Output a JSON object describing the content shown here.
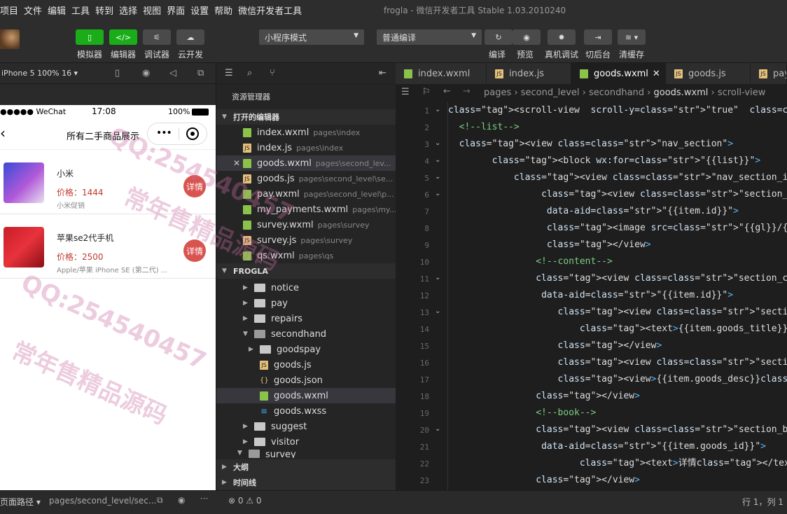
{
  "menu": [
    "项目",
    "文件",
    "编辑",
    "工具",
    "转到",
    "选择",
    "视图",
    "界面",
    "设置",
    "帮助",
    "微信开发者工具"
  ],
  "window_title": "frogla - 微信开发者工具 Stable 1.03.2010240",
  "toolbar": {
    "left_buttons": [
      "模拟器",
      "编辑器",
      "调试器",
      "云开发"
    ],
    "mode_select": "小程序模式",
    "compile_select": "普通编译",
    "right_buttons": [
      "编译",
      "预览",
      "真机调试",
      "切后台",
      "清缓存"
    ]
  },
  "simulator": {
    "device": "iPhone 5 100% 16 ▾",
    "status_left": "●●●●● WeChat",
    "status_time": "17:08",
    "status_battery": "100%",
    "nav_title": "所有二手商品展示",
    "items": [
      {
        "title": "小米",
        "price": "价格：1444",
        "desc": "小米促销",
        "button": "详情"
      },
      {
        "title": "苹果se2代手机",
        "price": "价格：2500",
        "desc": "Apple/苹果 iPhone SE (第二代) ...",
        "button": "详情"
      }
    ]
  },
  "explorer": {
    "title": "资源管理器",
    "open_editors_header": "打开的编辑器",
    "open_editors": [
      {
        "name": "index.wxml",
        "path": "pages\\index",
        "type": "wx"
      },
      {
        "name": "index.js",
        "path": "pages\\index",
        "type": "js"
      },
      {
        "name": "goods.wxml",
        "path": "pages\\second_lev...",
        "type": "wx",
        "selected": true
      },
      {
        "name": "goods.js",
        "path": "pages\\second_level\\se...",
        "type": "js"
      },
      {
        "name": "pay.wxml",
        "path": "pages\\second_level\\p...",
        "type": "wx"
      },
      {
        "name": "my_payments.wxml",
        "path": "pages\\my...",
        "type": "wx"
      },
      {
        "name": "survey.wxml",
        "path": "pages\\survey",
        "type": "wx"
      },
      {
        "name": "survey.js",
        "path": "pages\\survey",
        "type": "js"
      },
      {
        "name": "qs.wxml",
        "path": "pages\\qs",
        "type": "wx"
      }
    ],
    "project_header": "FROGLA",
    "tree": [
      {
        "name": "notice",
        "kind": "folder",
        "depth": 0
      },
      {
        "name": "pay",
        "kind": "folder",
        "depth": 0
      },
      {
        "name": "repairs",
        "kind": "folder",
        "depth": 0
      },
      {
        "name": "secondhand",
        "kind": "folder-open",
        "depth": 0
      },
      {
        "name": "goodspay",
        "kind": "folder",
        "depth": 1
      },
      {
        "name": "goods.js",
        "kind": "js",
        "depth": 1
      },
      {
        "name": "goods.json",
        "kind": "json",
        "depth": 1
      },
      {
        "name": "goods.wxml",
        "kind": "wx",
        "depth": 1,
        "selected": true
      },
      {
        "name": "goods.wxss",
        "kind": "css",
        "depth": 1
      },
      {
        "name": "suggest",
        "kind": "folder",
        "depth": 0
      },
      {
        "name": "visitor",
        "kind": "folder",
        "depth": 0
      },
      {
        "name": "survey",
        "kind": "folder-open",
        "depth": 0
      }
    ],
    "outline": "大纲",
    "timeline": "时间线"
  },
  "editor": {
    "tabs": [
      {
        "name": "index.wxml",
        "type": "wx"
      },
      {
        "name": "index.js",
        "type": "js"
      },
      {
        "name": "goods.wxml",
        "type": "wx",
        "active": true
      },
      {
        "name": "goods.js",
        "type": "js"
      },
      {
        "name": "pay",
        "type": "js"
      }
    ],
    "breadcrumb": [
      "pages",
      "second_level",
      "secondhand",
      "goods.wxml",
      "scroll-view"
    ],
    "code_lines": [
      "<scroll-view  scroll-y=\"true\"  class=\"page-body\" >",
      "  <!--list-->",
      "  <view class=\"nav_section\">",
      "        <block wx:for=\"{{list}}\">",
      "            <view class=\"nav_section_items\" >",
      "                 <view class=\"section_image\"",
      "                  data-aid=\"{{item.id}}\">",
      "                  <image src=\"{{gl}}/{{item.goods_img}}\" mode=\"",
      "                  </view>",
      "                <!--content-->",
      "                <view class=\"section_cont\"",
      "                 data-aid=\"{{item.id}}\">",
      "                    <view class=\"section_cont_sub\">",
      "                        <text>{{item.goods_title}}</text>",
      "                    </view>",
      "                    <view class=\"section_cont_price\">价格：{{ite",
      "                    <view>{{item.goods_desc}}</view>",
      "                </view>",
      "                <!--book-->",
      "                <view class=\"section_book\" bindtap=\"bookTap\"",
      "                 data-aid=\"{{item.goods_id}}\">",
      "                        <text>详情</text>",
      "                </view>"
    ]
  },
  "statusbar": {
    "page_path_label": "页面路径 ▾",
    "page_path": "pages/second_level/sec...",
    "problems": "⊗ 0 ⚠ 0",
    "cursor": "行 1，列 1"
  },
  "watermarks": [
    "QQ:254540457",
    "常年售精品源码",
    "QQ:254540457",
    "常年售精品源码"
  ]
}
